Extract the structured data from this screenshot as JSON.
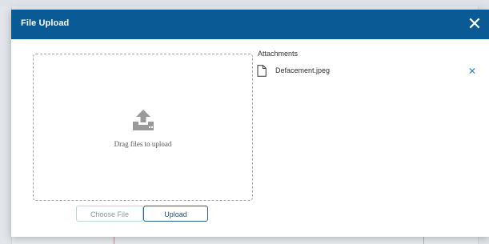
{
  "dialog": {
    "title": "File Upload",
    "close_icon": "close-icon"
  },
  "dropzone": {
    "icon": "upload-icon",
    "text": "Drag files to upload"
  },
  "buttons": {
    "choose_file": "Choose File",
    "upload": "Upload"
  },
  "attachments": {
    "label": "Attachments",
    "items": [
      {
        "name": "Defacement.jpeg",
        "icon": "file-icon",
        "remove_icon": "remove-icon"
      }
    ]
  },
  "colors": {
    "titlebar": "#0a5a96",
    "remove": "#2a7fd4"
  }
}
